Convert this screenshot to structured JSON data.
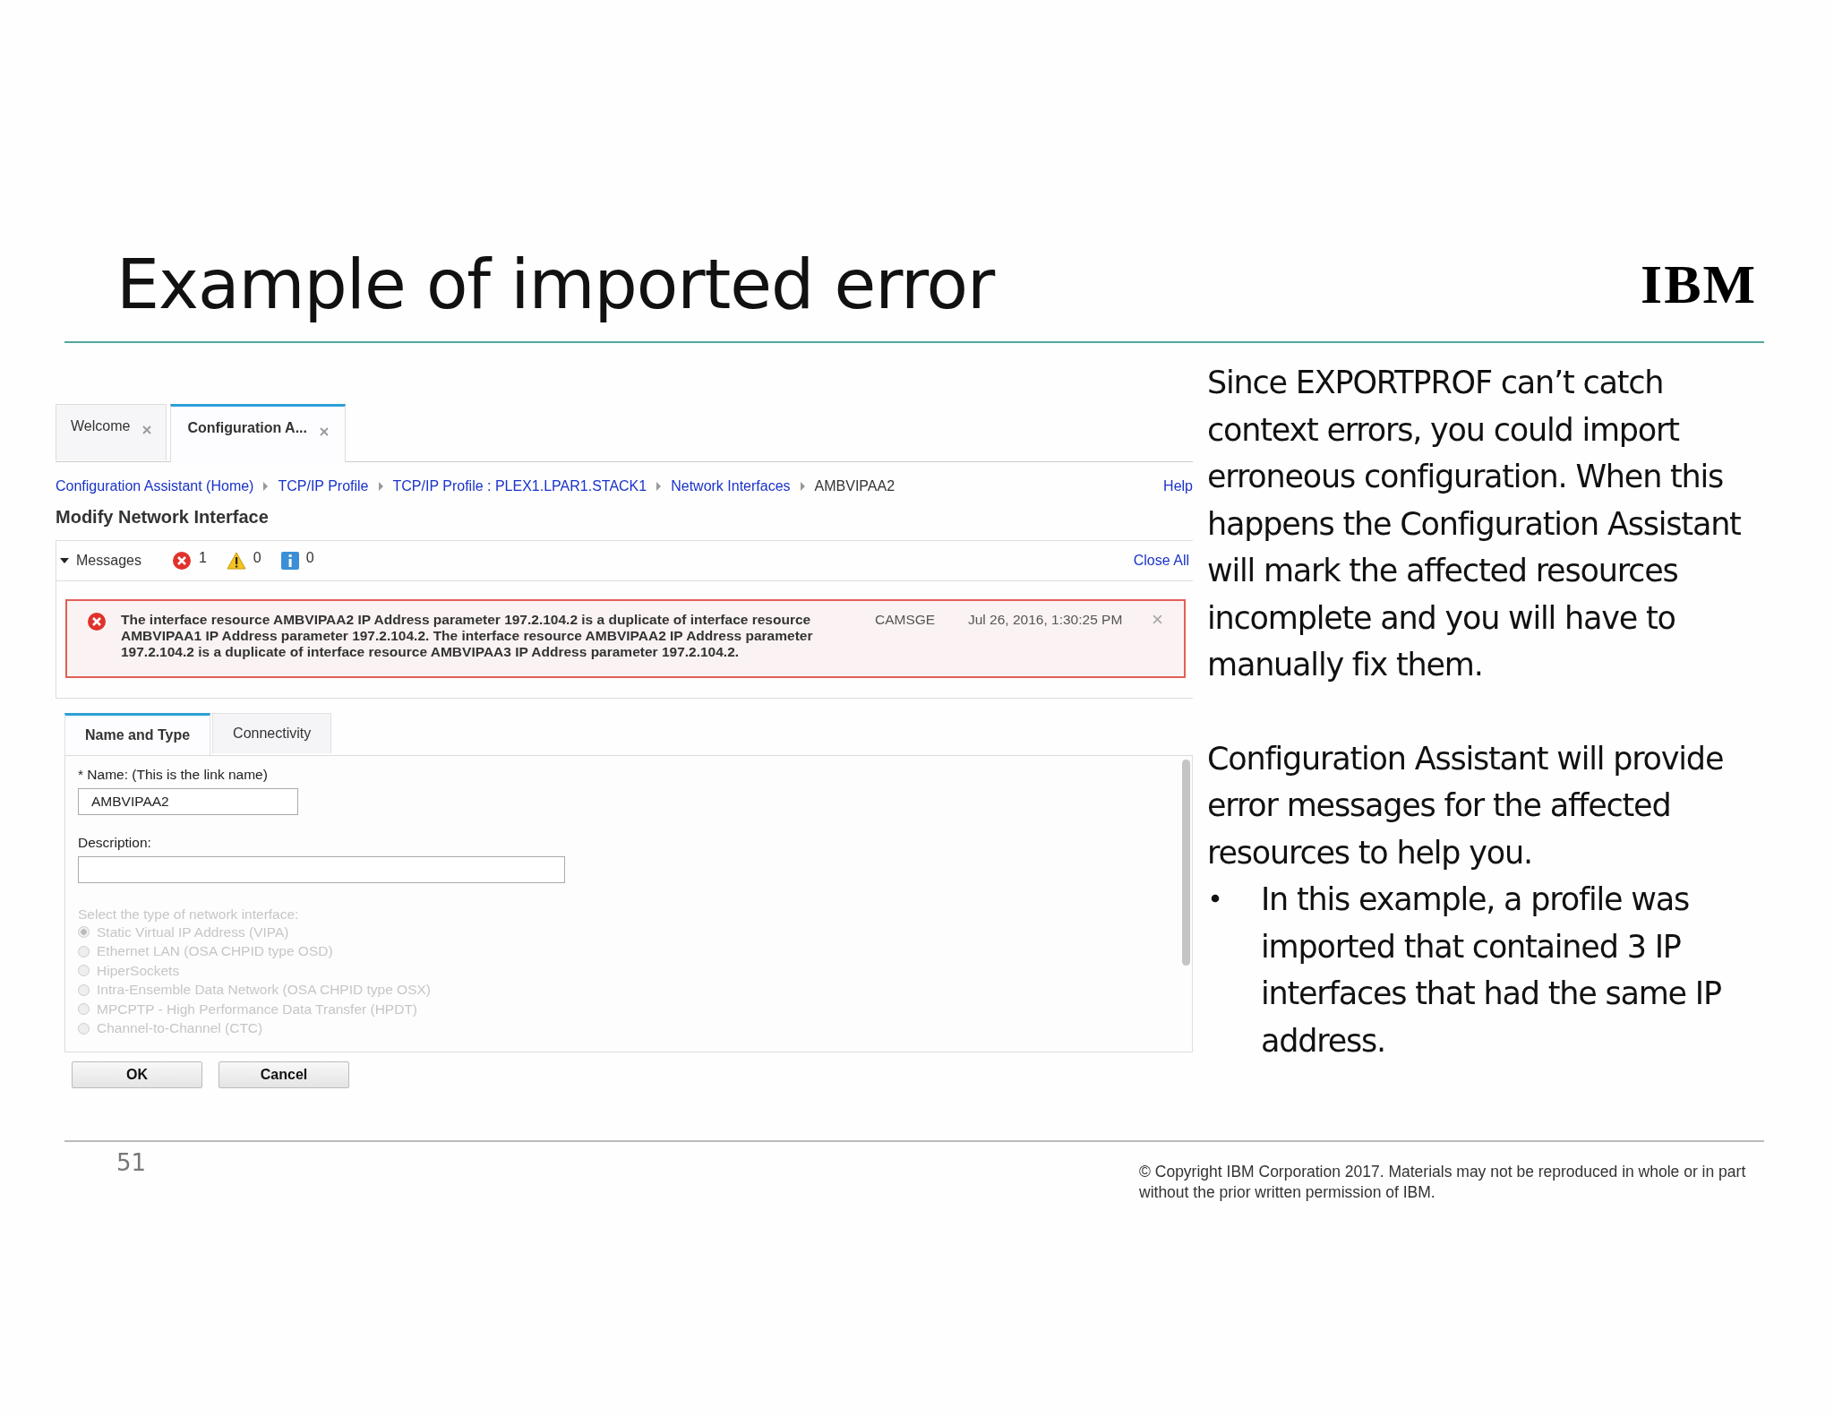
{
  "slide": {
    "title": "Example of imported error",
    "logo": "IBM",
    "page_number": "51",
    "copyright": "© Copyright IBM Corporation 2017.  Materials may not be reproduced in whole or in part without the prior written permission of IBM."
  },
  "screen": {
    "tabs": [
      {
        "label": "Welcome",
        "selected": false
      },
      {
        "label": "Configuration A...",
        "selected": true
      }
    ],
    "breadcrumb": [
      {
        "label": "Configuration Assistant (Home)",
        "link": true
      },
      {
        "label": "TCP/IP Profile",
        "link": true
      },
      {
        "label": "TCP/IP Profile : PLEX1.LPAR1.STACK1",
        "link": true
      },
      {
        "label": "Network Interfaces",
        "link": true
      },
      {
        "label": "AMBVIPAA2",
        "link": false
      }
    ],
    "help": "Help",
    "heading": "Modify Network Interface",
    "messages": {
      "label": "Messages",
      "expanded": true,
      "close_all": "Close All",
      "counts": [
        {
          "kind": "error",
          "count": "1"
        },
        {
          "kind": "warning",
          "count": "0"
        },
        {
          "kind": "info",
          "count": "0"
        }
      ],
      "items": [
        {
          "kind": "error",
          "text": "The interface resource AMBVIPAA2 IP Address parameter 197.2.104.2 is a duplicate of interface resource AMBVIPAA1 IP Address parameter 197.2.104.2. The interface resource AMBVIPAA2 IP Address parameter 197.2.104.2 is a duplicate of interface resource AMBVIPAA3 IP Address parameter 197.2.104.2.",
          "source": "CAMSGE",
          "time": "Jul 26, 2016, 1:30:25 PM"
        }
      ]
    },
    "subtabs": [
      {
        "label": "Name and Type",
        "selected": true
      },
      {
        "label": "Connectivity",
        "selected": false
      }
    ],
    "name_label": "* Name: (This is the link name)",
    "name_value": "AMBVIPAA2",
    "description_label": "Description:",
    "type_label": "Select the type of network interface:",
    "interface_types": [
      {
        "label": "Static Virtual IP Address (VIPA)",
        "checked": true,
        "disabled": true
      },
      {
        "label": "Ethernet LAN (OSA CHPID type OSD)",
        "checked": false,
        "disabled": true
      },
      {
        "label": "HiperSockets",
        "checked": false,
        "disabled": true
      },
      {
        "label": "Intra-Ensemble Data Network (OSA CHPID type OSX)",
        "checked": false,
        "disabled": true
      },
      {
        "label": "MPCPTP - High Performance Data Transfer (HPDT)",
        "checked": false,
        "disabled": true
      },
      {
        "label": "Channel-to-Channel (CTC)",
        "checked": false,
        "disabled": true
      }
    ],
    "buttons": [
      "OK",
      "Cancel"
    ]
  },
  "notes": {
    "paragraphs": [
      "Since EXPORTPROF can’t catch context errors, you could import erroneous configuration.  When this happens the Configuration Assistant will mark the affected resources incomplete and you will have to manually fix them.",
      "Configuration Assistant will provide error messages for the affected resources to help you."
    ],
    "bullets": [
      "In this example, a profile was imported that contained 3 IP interfaces that had the same IP address."
    ]
  }
}
